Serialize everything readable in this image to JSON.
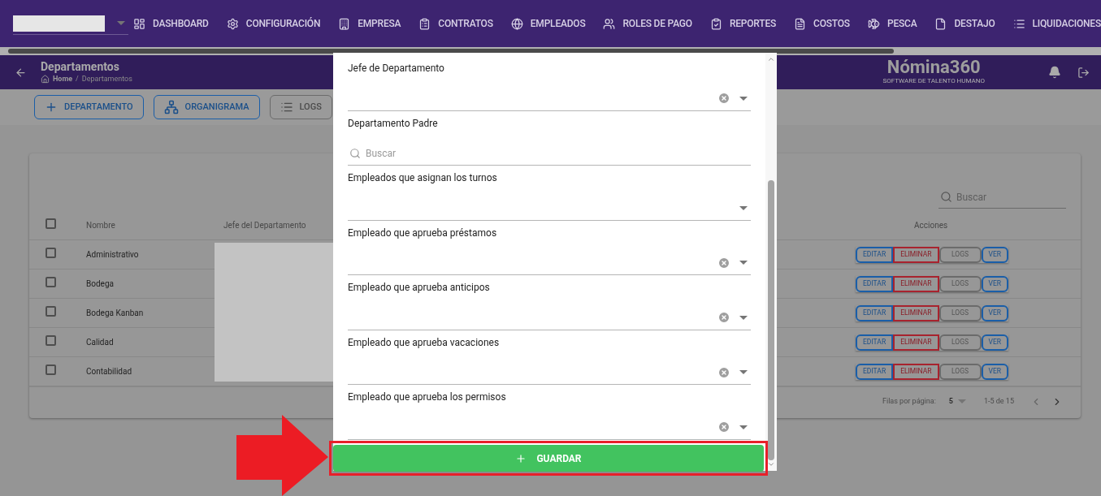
{
  "nav": [
    {
      "label": "DASHBOARD"
    },
    {
      "label": "CONFIGURACIÓN"
    },
    {
      "label": "EMPRESA"
    },
    {
      "label": "CONTRATOS"
    },
    {
      "label": "EMPLEADOS"
    },
    {
      "label": "ROLES DE PAGO"
    },
    {
      "label": "REPORTES"
    },
    {
      "label": "COSTOS"
    },
    {
      "label": "PESCA"
    },
    {
      "label": "DESTAJO"
    },
    {
      "label": "LIQUIDACIONES"
    }
  ],
  "header": {
    "title": "Departamentos",
    "breadcrumb": [
      "Home",
      "Departamentos"
    ],
    "breadcrumb_separator": "/",
    "logo": "Nómina360",
    "tagline": "SOFTWARE DE TALENTO HUMANO"
  },
  "toolbar": [
    {
      "label": "DEPARTAMENTO",
      "kind": "add"
    },
    {
      "label": "ORGANIGRAMA",
      "kind": "chart"
    },
    {
      "label": "LOGS",
      "kind": "logs"
    }
  ],
  "table": {
    "search_placeholder": "Buscar",
    "header_checked": false,
    "columns": [
      "Nombre",
      "Jefe del Departamento",
      "Acciones"
    ],
    "rows": [
      {
        "name": "Administrativo",
        "checked": false,
        "actions": [
          "EDITAR",
          "ELIMINAR",
          "LOGS",
          "VER"
        ]
      },
      {
        "name": "Bodega",
        "checked": false,
        "actions": [
          "EDITAR",
          "ELIMINAR",
          "LOGS",
          "VER"
        ]
      },
      {
        "name": "Bodega Kanban",
        "checked": false,
        "actions": [
          "EDITAR",
          "ELIMINAR",
          "LOGS",
          "VER"
        ]
      },
      {
        "name": "Calidad",
        "checked": false,
        "actions": [
          "EDITAR",
          "ELIMINAR",
          "LOGS",
          "VER"
        ]
      },
      {
        "name": "Contabilidad",
        "checked": false,
        "actions": [
          "EDITAR",
          "ELIMINAR",
          "LOGS",
          "VER"
        ]
      }
    ],
    "pagination": {
      "rows_label": "Filas por página:",
      "rows_per_page": "5",
      "range": "1-5 de 15"
    }
  },
  "modal": {
    "fields": [
      {
        "label": "Jefe de Departamento",
        "kind": "select",
        "clearable": true
      },
      {
        "label": "Departamento Padre",
        "kind": "search",
        "placeholder": "Buscar"
      },
      {
        "label": "Empleados que asignan los turnos",
        "kind": "select",
        "clearable": false
      },
      {
        "label": "Empleado que aprueba préstamos",
        "kind": "select",
        "clearable": true
      },
      {
        "label": "Empleado que aprueba anticipos",
        "kind": "select",
        "clearable": true
      },
      {
        "label": "Empleado que aprueba vacaciones",
        "kind": "select",
        "clearable": true
      },
      {
        "label": "Empleado que aprueba los permisos",
        "kind": "select",
        "clearable": true
      }
    ],
    "save": "GUARDAR"
  }
}
